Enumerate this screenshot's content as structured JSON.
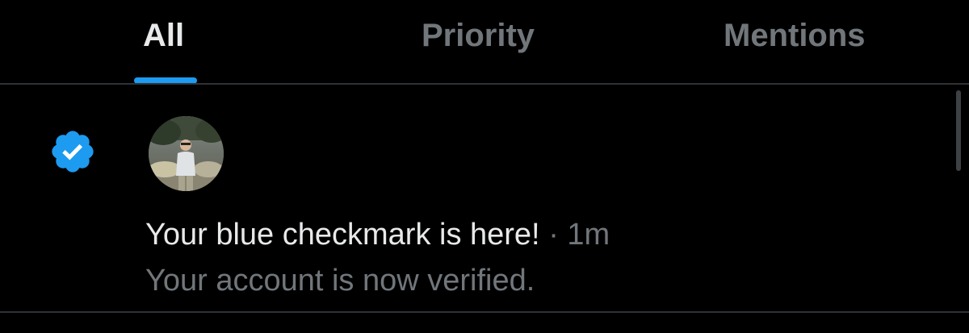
{
  "tabs": [
    {
      "label": "All",
      "active": true
    },
    {
      "label": "Priority",
      "active": false
    },
    {
      "label": "Mentions",
      "active": false
    }
  ],
  "notification": {
    "icon": "verified-badge-icon",
    "avatar": "user-avatar",
    "title": "Your blue checkmark is here!",
    "separator": "·",
    "time": "1m",
    "body": "Your account is now verified."
  },
  "colors": {
    "background": "#000000",
    "accent": "#1d9bf0",
    "primary_text": "#e7e9ea",
    "secondary_text": "#71767b",
    "divider": "#2f3336"
  }
}
